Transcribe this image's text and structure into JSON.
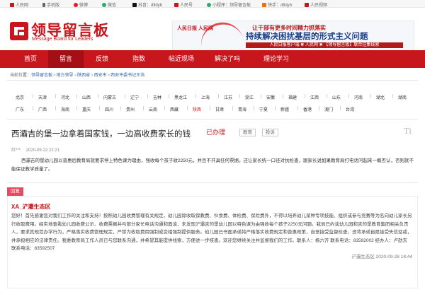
{
  "topbar": {
    "items": [
      {
        "label": "人民网",
        "icon": "renminwang-icon",
        "color": "#c8161d"
      },
      {
        "label": "手机版",
        "icon": "phone-icon",
        "color": "#666666"
      },
      {
        "label": "微博",
        "icon": "weibo-icon",
        "color": "#e6162d"
      },
      {
        "label": "微信",
        "icon": "wechat-icon",
        "color": "#2aae67"
      },
      {
        "label": "抖音：dfldyb",
        "icon": "douyin-icon",
        "color": "#111111"
      },
      {
        "label": "人民号",
        "icon": "renminhao-icon",
        "color": "#c8161d"
      },
      {
        "label": "小程序：领导留言板",
        "icon": "miniprogram-icon",
        "color": "#2aae67"
      },
      {
        "label": "快手：dfldyb",
        "icon": "kuaishou-icon",
        "color": "#ff6a00"
      },
      {
        "label": "人民视频",
        "icon": "video-icon",
        "color": "#c8161d"
      }
    ]
  },
  "header": {
    "logo_cn": "领导留言板",
    "logo_en": "Message Board for Leaders",
    "brand_color": "#c8161d"
  },
  "banner": {
    "brand": "人民日报 人民网",
    "line1": "让干部有更多时间精力抓落实",
    "line2": "持续解决困扰基层的形式主义问题",
    "line3": "人民日报客户端 ✖ 人民网 ✖ 【领导留言板】联合征集线索"
  },
  "nav": {
    "items": [
      "首页",
      "留言",
      "反馈",
      "指数",
      "帖近现场",
      "解决了吗",
      "理论学习"
    ],
    "active": "留言"
  },
  "breadcrumb": {
    "prefix": "当前位置：",
    "items": [
      "领导留言板",
      "地方领导",
      "陕西省",
      "西安市",
      "西安市委书记王浩"
    ]
  },
  "regions": {
    "row1": [
      "北京",
      "天津",
      "河北",
      "山西",
      "内蒙古",
      "辽宁",
      "吉林",
      "黑龙江",
      "上海",
      "江苏",
      "浙江",
      "安徽",
      "福建",
      "江西",
      "山东",
      "河南",
      "湖北",
      "湖南"
    ],
    "row2": [
      "广东",
      "广西",
      "海南",
      "重庆",
      "四川",
      "贵州",
      "云南",
      "西藏",
      "陕西",
      "甘肃",
      "青海",
      "宁夏",
      "新疆",
      "香港",
      "澳门",
      "台湾"
    ],
    "active": "陕西"
  },
  "message": {
    "title": "西灞吉的堡一边拿着国家钱，一边高收费家长的钱",
    "status": "已办理",
    "tags": [
      "教育",
      "投诉"
    ],
    "side_mark": "Ti",
    "author": "红***",
    "time": "2020-09-22 22:21",
    "body": "西灞吉的堡幼儿园以普惠后教育局就要求停上特色课为理由，强收每个孩子收2250元，并且不开具任何票据。还让家长统一口径对抗检查，跟家长说如果教育局打电话问起来一概否认，否则就不能保证教学质量了。"
  },
  "reply": {
    "tag": "回复",
    "org": "XA_浐灞生态区",
    "text": "您好！首先感谢您对我们工作的关注和支持！按照幼儿园收费管理有关规定，幼儿园除收取保教费、伙食费、体检费、保险费外，不得以培养幼儿某种专项技能、组织或参与竞赛等为名向幼儿家长另行收取费用。经实地查看幼儿园收费公示、收费票据并与部分家长电话沟通和面谈，未发现浐灞吉的堡幼儿园以特色课为由强收每个孩子2250元问题。我局已约谈幼儿园和吉的堡教育集团相关负责人，要求其规范办学行为，严格落实收费管理规定，严禁为收取费用强制或变相强制提供服务。幼儿园已书面承诺将严格落实收费规定和普惠政策，自觉接受监督检查，违背承诺自愿接受失信惩戒，并承担相应的法律责任。我委教育局工作人员已与您联系沟通，并希望其能提供线索，方便进一步核查。欢迎您继续关注并监督我们的工作。联系人：杨六齐 联系电话：83592002 经办人：卢劭东 联系电话：83592507",
    "footer": "浐灞生态区 2020-09-28 18:44"
  }
}
